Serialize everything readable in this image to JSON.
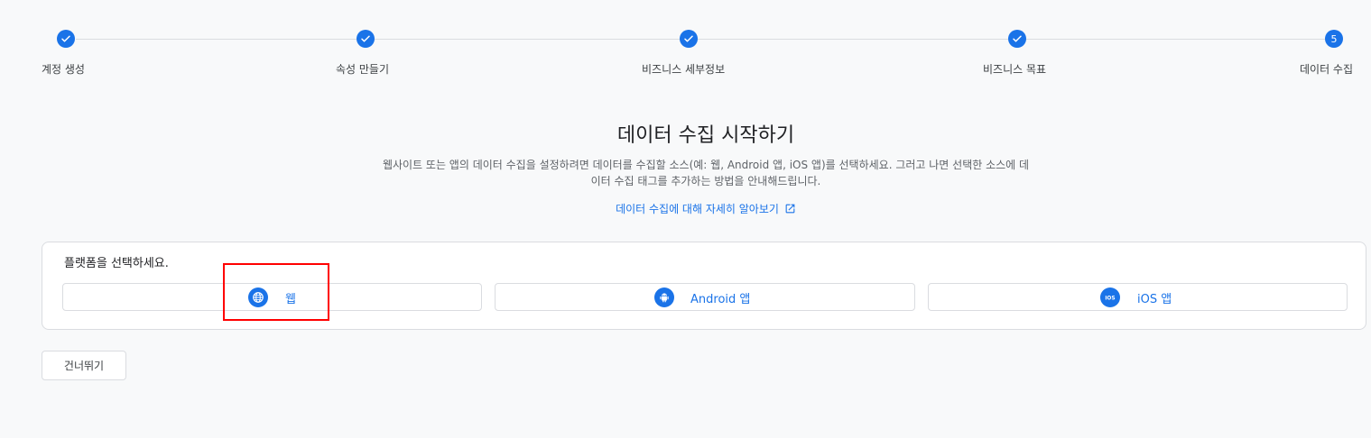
{
  "stepper": {
    "steps": [
      {
        "label": "계정 생성",
        "state": "done"
      },
      {
        "label": "속성 만들기",
        "state": "done"
      },
      {
        "label": "비즈니스 세부정보",
        "state": "done"
      },
      {
        "label": "비즈니스 목표",
        "state": "done"
      },
      {
        "label": "데이터 수집",
        "state": "current",
        "number": "5"
      }
    ]
  },
  "intro": {
    "title": "데이터 수집 시작하기",
    "description": "웹사이트 또는 앱의 데이터 수집을 설정하려면 데이터를 수집할 소스(예: 웹, Android 앱, iOS 앱)를 선택하세요. 그러고 나면 선택한 소스에 데이터 수집 태그를 추가하는 방법을 안내해드립니다.",
    "learn_more": "데이터 수집에 대해 자세히 알아보기"
  },
  "platform": {
    "prompt": "플랫폼을 선택하세요.",
    "options": [
      {
        "label": "웹",
        "icon": "globe-icon"
      },
      {
        "label": "Android 앱",
        "icon": "android-icon"
      },
      {
        "label": "iOS 앱",
        "icon": "ios-icon"
      }
    ]
  },
  "skip_label": "건너뛰기",
  "colors": {
    "accent": "#1a73e8",
    "background": "#f8f9fa",
    "border": "#dadce0",
    "highlight": "#ff0000"
  }
}
